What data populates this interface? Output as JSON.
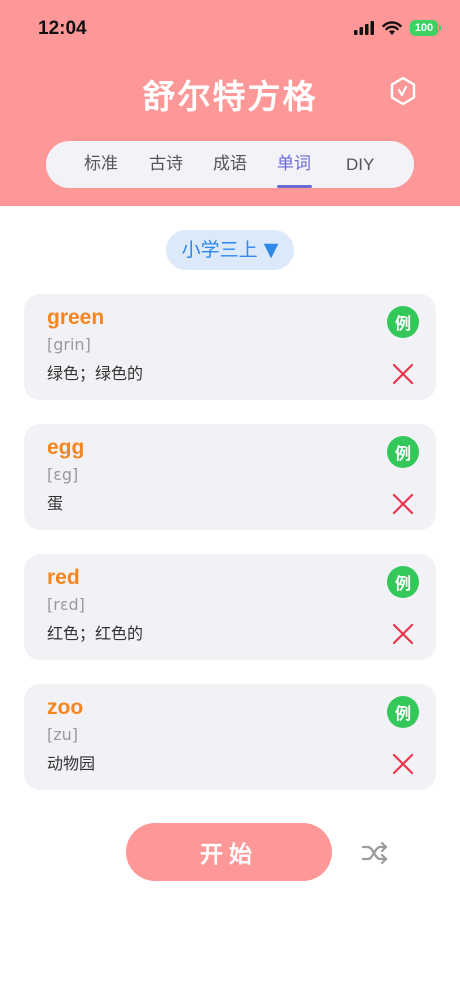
{
  "status_bar": {
    "time": "12:04",
    "battery": "100"
  },
  "app": {
    "title": "舒尔特方格"
  },
  "tabs": [
    {
      "label": "标准"
    },
    {
      "label": "古诗"
    },
    {
      "label": "成语"
    },
    {
      "label": "单词"
    },
    {
      "label": "DIY"
    }
  ],
  "active_tab": "单词",
  "grade_select": {
    "value": "小学三上 ▼"
  },
  "words": [
    {
      "word": "green",
      "phonetic": "[grin]",
      "meaning": "绿色；绿色的",
      "example_label": "例"
    },
    {
      "word": "egg",
      "phonetic": "[ɛg]",
      "meaning": "蛋",
      "example_label": "例"
    },
    {
      "word": "red",
      "phonetic": "[rɛd]",
      "meaning": "红色；红色的",
      "example_label": "例"
    },
    {
      "word": "zoo",
      "phonetic": "[zu]",
      "meaning": "动物园",
      "example_label": "例"
    }
  ],
  "start_button": {
    "label": "开始"
  },
  "colors": {
    "header": "#fe9898",
    "accent": "#6b6bd6",
    "word": "#f5861f",
    "example": "#34c759",
    "delete": "#e8384f"
  },
  "icons": {
    "timer": "hexagon-timer-icon",
    "delete": "close-icon",
    "shuffle": "shuffle-icon"
  }
}
